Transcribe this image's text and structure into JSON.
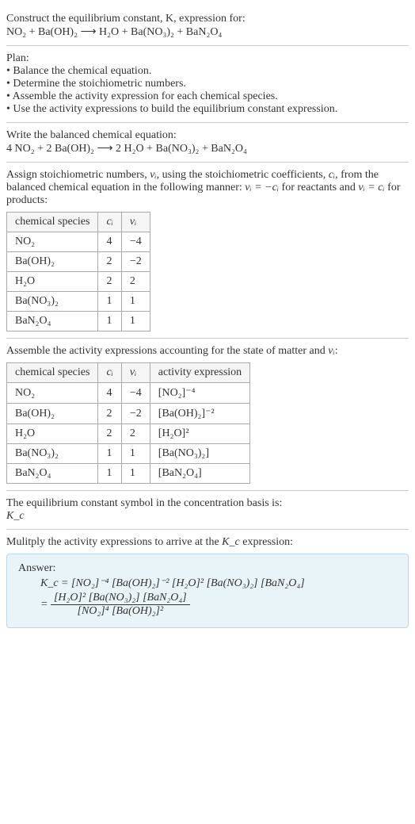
{
  "s1": {
    "line1": "Construct the equilibrium constant, K, expression for:",
    "eq": "NO₂ + Ba(OH)₂ ⟶ H₂O + Ba(NO₃)₂ + BaN₂O₄"
  },
  "s2": {
    "heading": "Plan:",
    "b1": "• Balance the chemical equation.",
    "b2": "• Determine the stoichiometric numbers.",
    "b3": "• Assemble the activity expression for each chemical species.",
    "b4": "• Use the activity expressions to build the equilibrium constant expression."
  },
  "s3": {
    "line1": "Write the balanced chemical equation:",
    "eq": "4 NO₂ + 2 Ba(OH)₂ ⟶ 2 H₂O + Ba(NO₃)₂ + BaN₂O₄"
  },
  "s4": {
    "p1a": "Assign stoichiometric numbers, ",
    "p1b": ", using the stoichiometric coefficients, ",
    "p1c": ", from the balanced chemical equation in the following manner: ",
    "p1d": " for reactants and ",
    "p1e": " for products:",
    "nu_i": "νᵢ",
    "c_i": "cᵢ",
    "rel1": "νᵢ = −cᵢ",
    "rel2": "νᵢ = cᵢ",
    "h1": "chemical species",
    "h2": "cᵢ",
    "h3": "νᵢ",
    "r1c1": "NO₂",
    "r1c2": "4",
    "r1c3": "−4",
    "r2c1": "Ba(OH)₂",
    "r2c2": "2",
    "r2c3": "−2",
    "r3c1": "H₂O",
    "r3c2": "2",
    "r3c3": "2",
    "r4c1": "Ba(NO₃)₂",
    "r4c2": "1",
    "r4c3": "1",
    "r5c1": "BaN₂O₄",
    "r5c2": "1",
    "r5c3": "1"
  },
  "s5": {
    "p1a": "Assemble the activity expressions accounting for the state of matter and ",
    "p1b": ":",
    "nu_i": "νᵢ",
    "h1": "chemical species",
    "h2": "cᵢ",
    "h3": "νᵢ",
    "h4": "activity expression",
    "r1c1": "NO₂",
    "r1c2": "4",
    "r1c3": "−4",
    "r1c4": "[NO₂]⁻⁴",
    "r2c1": "Ba(OH)₂",
    "r2c2": "2",
    "r2c3": "−2",
    "r2c4": "[Ba(OH)₂]⁻²",
    "r3c1": "H₂O",
    "r3c2": "2",
    "r3c3": "2",
    "r3c4": "[H₂O]²",
    "r4c1": "Ba(NO₃)₂",
    "r4c2": "1",
    "r4c3": "1",
    "r4c4": "[Ba(NO₃)₂]",
    "r5c1": "BaN₂O₄",
    "r5c2": "1",
    "r5c3": "1",
    "r5c4": "[BaN₂O₄]"
  },
  "s6": {
    "line1": "The equilibrium constant symbol in the concentration basis is:",
    "kc": "K_c"
  },
  "s7": {
    "line1a": "Mulitply the activity expressions to arrive at the ",
    "kc": "K_c",
    "line1b": " expression:",
    "answer_label": "Answer:",
    "eq1": "K_c = [NO₂]⁻⁴ [Ba(OH)₂]⁻² [H₂O]² [Ba(NO₃)₂] [BaN₂O₄]",
    "eq2_prefix": "= ",
    "eq2_num": "[H₂O]² [Ba(NO₃)₂] [BaN₂O₄]",
    "eq2_den": "[NO₂]⁴ [Ba(OH)₂]²"
  }
}
